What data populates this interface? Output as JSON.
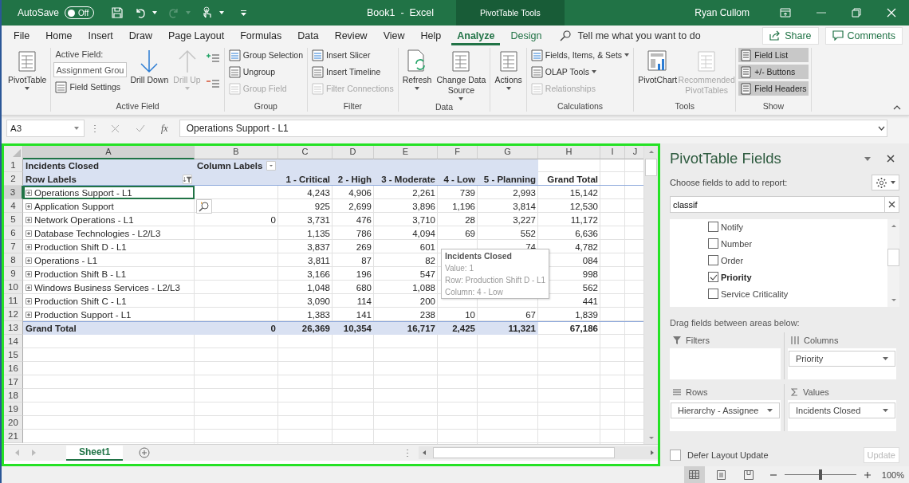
{
  "title_bar": {
    "autosave_label": "AutoSave",
    "autosave_state": "Off",
    "autosave_on": false,
    "title": "Book1  -  Excel",
    "context_label": "PivotTable Tools",
    "user": "Ryan Cullom"
  },
  "menu_tabs": [
    {
      "label": "File",
      "selected": false,
      "kind": "plain"
    },
    {
      "label": "Home",
      "selected": false,
      "kind": "plain"
    },
    {
      "label": "Insert",
      "selected": false,
      "kind": "plain"
    },
    {
      "label": "Draw",
      "selected": false,
      "kind": "plain"
    },
    {
      "label": "Page Layout",
      "selected": false,
      "kind": "plain"
    },
    {
      "label": "Formulas",
      "selected": false,
      "kind": "plain"
    },
    {
      "label": "Data",
      "selected": false,
      "kind": "plain"
    },
    {
      "label": "Review",
      "selected": false,
      "kind": "plain"
    },
    {
      "label": "View",
      "selected": false,
      "kind": "plain"
    },
    {
      "label": "Help",
      "selected": false,
      "kind": "plain"
    },
    {
      "label": "Analyze",
      "selected": true,
      "kind": "context"
    },
    {
      "label": "Design",
      "selected": false,
      "kind": "context"
    }
  ],
  "tell_me": {
    "placeholder": "Tell me what you want to do"
  },
  "share": "Share",
  "comments": "Comments",
  "ribbon": {
    "groups": [
      {
        "columns": [
          [
            {
              "kind": "large",
              "label": "PivotTable",
              "dropdown": true,
              "disabled": false
            }
          ]
        ]
      },
      {
        "label": "Active Field",
        "columns": [
          [
            {
              "kind": "caption",
              "label": "Active Field:"
            },
            {
              "kind": "field",
              "value": "Assignment Grou"
            },
            {
              "kind": "small",
              "label": "Field Settings",
              "disabled": false
            }
          ],
          [
            {
              "kind": "large",
              "label": "Drill Down",
              "disabled": false
            }
          ],
          [
            {
              "kind": "large",
              "label": "Drill Up",
              "dropdown": true,
              "disabled": true
            }
          ],
          [
            {
              "kind": "icon"
            },
            {
              "kind": "icon"
            }
          ]
        ]
      },
      {
        "label": "Group",
        "columns": [
          [
            {
              "kind": "small",
              "label": "Group Selection",
              "disabled": false
            },
            {
              "kind": "small",
              "label": "Ungroup",
              "disabled": false
            },
            {
              "kind": "small",
              "label": "Group Field",
              "disabled": true
            }
          ]
        ]
      },
      {
        "label": "Filter",
        "columns": [
          [
            {
              "kind": "small",
              "label": "Insert Slicer",
              "disabled": false
            },
            {
              "kind": "small",
              "label": "Insert Timeline",
              "disabled": false
            },
            {
              "kind": "small",
              "label": "Filter Connections",
              "disabled": true
            }
          ]
        ]
      },
      {
        "label": "Data",
        "columns": [
          [
            {
              "kind": "large",
              "label": "Refresh",
              "dropdown": true,
              "disabled": false
            }
          ],
          [
            {
              "kind": "large",
              "label": "Change Data Source",
              "dropdown": true,
              "disabled": false
            }
          ]
        ]
      },
      {
        "columns": [
          [
            {
              "kind": "large",
              "label": "Actions",
              "dropdown": true,
              "disabled": false
            }
          ]
        ]
      },
      {
        "label": "Calculations",
        "columns": [
          [
            {
              "kind": "small",
              "label": "Fields, Items, & Sets",
              "dropdown": true,
              "disabled": false
            },
            {
              "kind": "small",
              "label": "OLAP Tools",
              "dropdown": true,
              "disabled": false
            },
            {
              "kind": "small",
              "label": "Relationships",
              "disabled": true
            }
          ]
        ]
      },
      {
        "label": "Tools",
        "columns": [
          [
            {
              "kind": "large",
              "label": "PivotChart",
              "disabled": false
            }
          ],
          [
            {
              "kind": "large",
              "label": "Recommended PivotTables",
              "disabled": true
            }
          ]
        ]
      },
      {
        "label": "Show",
        "columns": [
          [
            {
              "kind": "toggle",
              "label": "Field List",
              "on": true
            },
            {
              "kind": "toggle",
              "label": "+/- Buttons",
              "on": true
            },
            {
              "kind": "toggle",
              "label": "Field Headers",
              "on": true
            }
          ]
        ]
      }
    ]
  },
  "formula_bar": {
    "name_box": "A3",
    "function_label": "fx",
    "formula": "Operations Support - L1"
  },
  "sheet": {
    "column_letters": [
      "A",
      "B",
      "C",
      "D",
      "E",
      "F",
      "G",
      "H",
      "I",
      "J"
    ],
    "rows": [
      {
        "number": "1",
        "kind": "title",
        "selected": false,
        "cells": [
          "Incidents Closed",
          "Column Labels",
          null,
          null,
          null,
          null,
          null,
          null
        ]
      },
      {
        "number": "2",
        "kind": "header",
        "selected": false,
        "cells": [
          "Row Labels",
          null,
          "1 - Critical",
          "2 - High",
          "3 - Moderate",
          "4 - Low",
          "5 - Planning",
          "Grand Total"
        ]
      },
      {
        "number": "3",
        "kind": "item",
        "selected": true,
        "cells": [
          "Operations Support - L1",
          null,
          "4,243",
          "4,906",
          "2,261",
          "739",
          "2,993",
          "15,142"
        ]
      },
      {
        "number": "4",
        "kind": "item",
        "selected": false,
        "cells": [
          "Application Support",
          null,
          "925",
          "2,699",
          "3,896",
          "1,196",
          "3,814",
          "12,530"
        ]
      },
      {
        "number": "5",
        "kind": "item",
        "selected": false,
        "cells": [
          "Network Operations - L1",
          "0",
          "3,731",
          "476",
          "3,710",
          "28",
          "3,227",
          "11,172"
        ]
      },
      {
        "number": "6",
        "kind": "item",
        "selected": false,
        "cells": [
          "Database Technologies - L2/L3",
          null,
          "1,135",
          "786",
          "4,094",
          "69",
          "552",
          "6,636"
        ]
      },
      {
        "number": "7",
        "kind": "item",
        "selected": false,
        "cells": [
          "Production Shift D - L1",
          null,
          "3,837",
          "269",
          "601",
          null,
          "74",
          "4,782"
        ]
      },
      {
        "number": "8",
        "kind": "item",
        "selected": false,
        "cells": [
          "Operations - L1",
          null,
          "3,811",
          "87",
          "82",
          null,
          null,
          "084"
        ]
      },
      {
        "number": "9",
        "kind": "item",
        "selected": false,
        "cells": [
          "Production Shift B - L1",
          null,
          "3,166",
          "196",
          "547",
          null,
          null,
          "998"
        ]
      },
      {
        "number": "10",
        "kind": "item",
        "selected": false,
        "cells": [
          "Windows Business Services - L2/L3",
          null,
          "1,048",
          "680",
          "1,088",
          null,
          null,
          "562"
        ]
      },
      {
        "number": "11",
        "kind": "item",
        "selected": false,
        "cells": [
          "Production Shift C - L1",
          null,
          "3,090",
          "114",
          "200",
          null,
          null,
          "441"
        ]
      },
      {
        "number": "12",
        "kind": "item",
        "selected": false,
        "cells": [
          "Production Support - L1",
          null,
          "1,383",
          "141",
          "238",
          "10",
          "67",
          "1,839"
        ]
      },
      {
        "number": "13",
        "kind": "total",
        "selected": false,
        "cells": [
          "Grand Total",
          "0",
          "26,369",
          "10,354",
          "16,717",
          "2,425",
          "11,321",
          "67,186"
        ]
      },
      {
        "number": "14",
        "kind": "empty",
        "selected": false
      },
      {
        "number": "15",
        "kind": "empty",
        "selected": false
      },
      {
        "number": "16",
        "kind": "empty",
        "selected": false
      },
      {
        "number": "17",
        "kind": "empty",
        "selected": false
      },
      {
        "number": "18",
        "kind": "empty",
        "selected": false
      },
      {
        "number": "19",
        "kind": "empty",
        "selected": false
      },
      {
        "number": "20",
        "kind": "empty",
        "selected": false
      },
      {
        "number": "21",
        "kind": "empty",
        "selected": false
      }
    ],
    "tooltip": {
      "title": "Incidents Closed",
      "lines": [
        "Value: 1",
        "Row: Production Shift D - L1",
        "Column: 4 - Low"
      ]
    },
    "sheet_tabs": [
      {
        "label": "Sheet1",
        "selected": true
      }
    ]
  },
  "pivot_pane": {
    "title": "PivotTable Fields",
    "subtitle": "Choose fields to add to report:",
    "search": {
      "value": "classif"
    },
    "fields": [
      {
        "label": "Notify",
        "checked": false
      },
      {
        "label": "Number",
        "checked": false
      },
      {
        "label": "Order",
        "checked": false
      },
      {
        "label": "Priority",
        "checked": true
      },
      {
        "label": "Service Criticality",
        "checked": false
      }
    ],
    "areas_hint": "Drag fields between areas below:",
    "areas": [
      {
        "label": "Filters",
        "kind": "filters"
      },
      {
        "label": "Columns",
        "kind": "columns",
        "items": [
          "Priority"
        ]
      },
      {
        "label": "Rows",
        "kind": "rows",
        "items": [
          "Hierarchy - Assignee"
        ]
      },
      {
        "label": "Values",
        "kind": "values",
        "items": [
          "Incidents Closed"
        ]
      }
    ],
    "defer": {
      "label": "Defer Layout Update",
      "checked": false
    },
    "update": {
      "label": "Update",
      "disabled": true
    }
  },
  "status_bar": {
    "views": [
      {
        "kind": "normal",
        "selected": true
      },
      {
        "kind": "layout",
        "selected": false
      },
      {
        "kind": "break",
        "selected": false
      }
    ],
    "zoom": {
      "level": 0.5
    },
    "zoom_label": "100%"
  }
}
